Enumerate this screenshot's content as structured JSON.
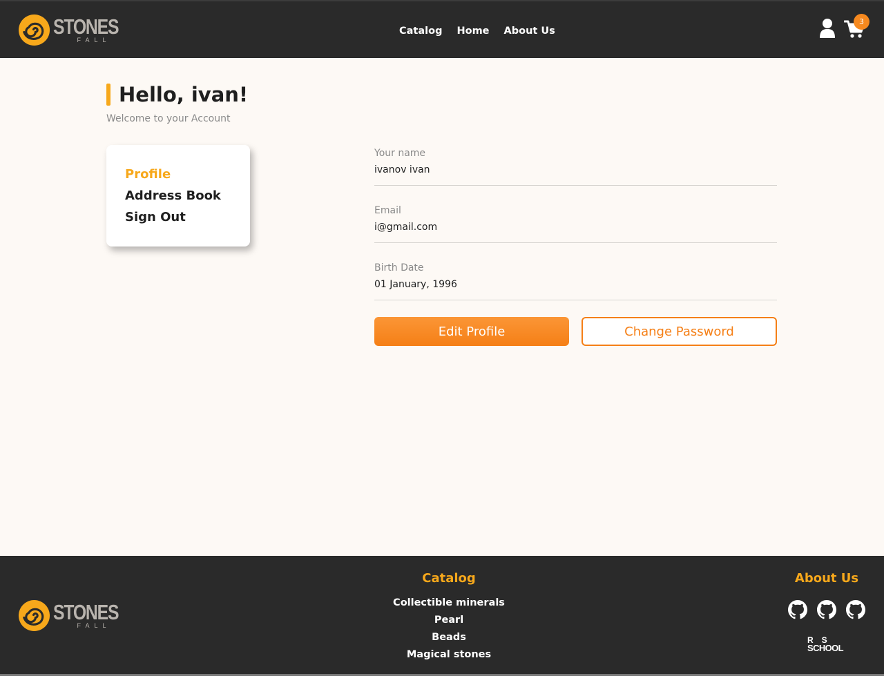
{
  "header": {
    "logo_word": "STONES",
    "logo_sub": "FALL",
    "nav": [
      "Catalog",
      "Home",
      "About Us"
    ],
    "cart_count": "3"
  },
  "main": {
    "greeting": "Hello, ivan!",
    "welcome": "Welcome to your Account",
    "sidebar": {
      "items": [
        {
          "label": "Profile",
          "active": true
        },
        {
          "label": "Address Book",
          "active": false
        },
        {
          "label": "Sign Out",
          "active": false
        }
      ]
    },
    "fields": [
      {
        "label": "Your name",
        "value": "ivanov ivan"
      },
      {
        "label": "Email",
        "value": "i@gmail.com"
      },
      {
        "label": "Birth Date",
        "value": "01 January, 1996"
      }
    ],
    "buttons": {
      "edit": "Edit Profile",
      "change_password": "Change Password"
    }
  },
  "footer": {
    "logo_word": "STONES",
    "logo_sub": "FALL",
    "catalog_title": "Catalog",
    "catalog_links": [
      "Collectible minerals",
      "Pearl",
      "Beads",
      "Magical stones"
    ],
    "about_title": "About Us",
    "github_icons": [
      "github-icon",
      "github-icon",
      "github-icon"
    ],
    "school_logo": {
      "line1": "RS",
      "line2": "SCHOOL"
    }
  },
  "colors": {
    "accent": "#f7a81b",
    "button_orange": "#f57f16",
    "dark": "#2a2a2a",
    "background": "#fdf9f5"
  }
}
